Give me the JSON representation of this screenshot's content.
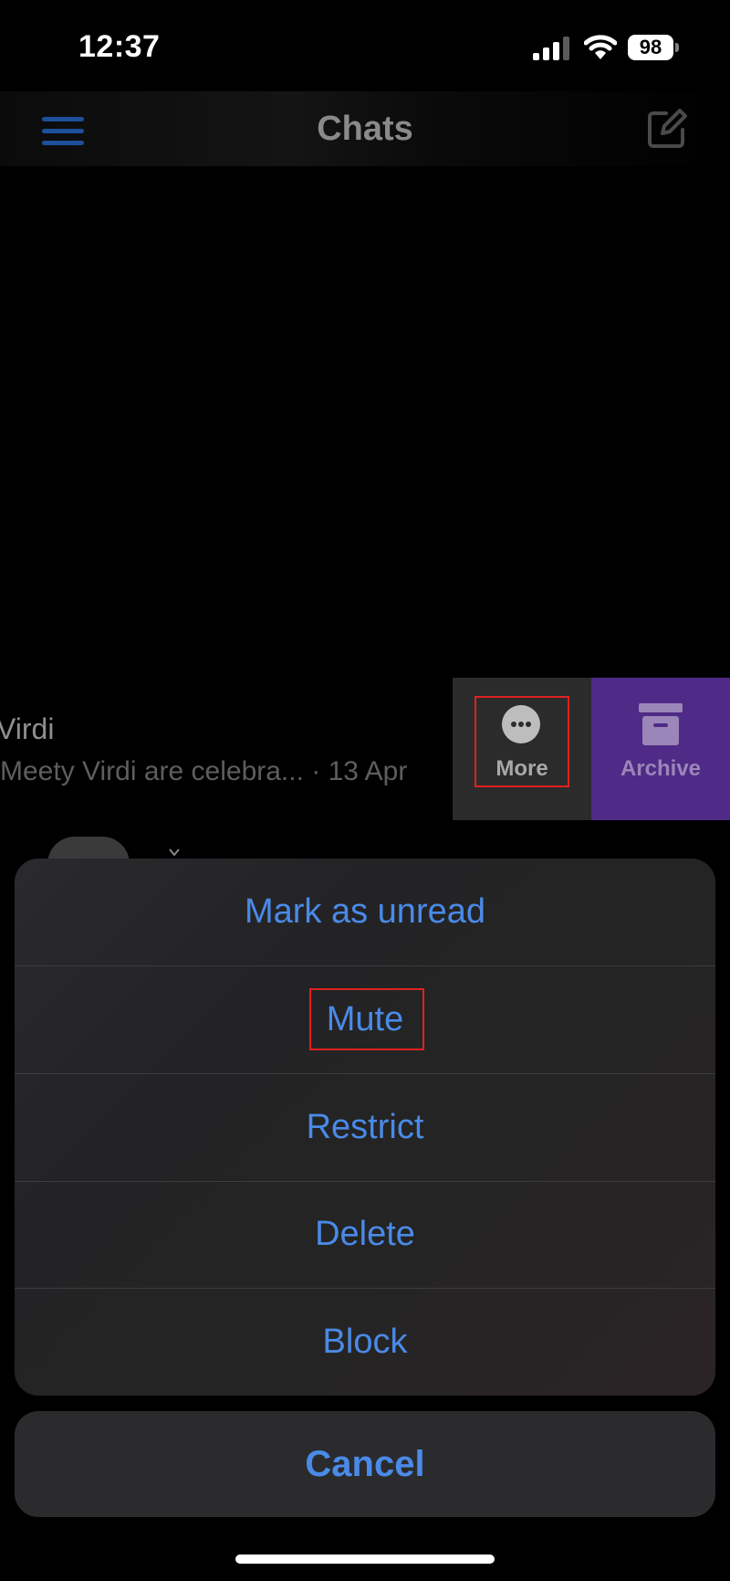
{
  "status_bar": {
    "time": "12:37",
    "battery": "98"
  },
  "header": {
    "title": "Chats",
    "menu_icon": "hamburger-menu-icon",
    "compose_icon": "compose-icon"
  },
  "chat_row": {
    "name": "Virdi",
    "preview": "Meety Virdi are celebra... · 13 Apr",
    "swipe_actions": [
      {
        "label": "More",
        "icon": "ellipsis-icon"
      },
      {
        "label": "Archive",
        "icon": "archive-icon",
        "color": "#4f2a86"
      }
    ]
  },
  "action_sheet": {
    "items": [
      {
        "label": "Mark as unread"
      },
      {
        "label": "Mute"
      },
      {
        "label": "Restrict"
      },
      {
        "label": "Delete"
      },
      {
        "label": "Block"
      }
    ],
    "cancel_label": "Cancel"
  },
  "colors": {
    "action_text": "#4a8ae8",
    "highlight": "#e02020"
  }
}
